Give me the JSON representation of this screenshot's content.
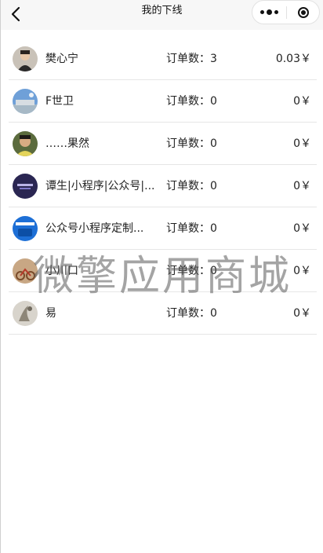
{
  "nav": {
    "title": "我的下线"
  },
  "icons": {
    "back": "chevron-left-icon",
    "more": "more-dots-icon",
    "close": "target-circle-icon"
  },
  "colors": {
    "nav_bg": "#f7f7f7",
    "divider": "#e6e6e6",
    "text": "#222222"
  },
  "list": [
    {
      "name": "樊心宁",
      "order_label": "订单数：",
      "order_count": "3",
      "amount": "0.03￥"
    },
    {
      "name": "F世卫",
      "order_label": "订单数：",
      "order_count": "0",
      "amount": "0￥"
    },
    {
      "name": "……果然",
      "order_label": "订单数：",
      "order_count": "0",
      "amount": "0￥"
    },
    {
      "name": "谭生|小程序|公众号|...",
      "order_label": "订单数：",
      "order_count": "0",
      "amount": "0￥"
    },
    {
      "name": "公众号小程序定制...",
      "order_label": "订单数：",
      "order_count": "0",
      "amount": "0￥"
    },
    {
      "name": "小川口",
      "order_label": "订单数：",
      "order_count": "0",
      "amount": "0￥"
    },
    {
      "name": "易",
      "order_label": "订单数：",
      "order_count": "0",
      "amount": "0￥"
    }
  ],
  "watermark": "微擎应用商城"
}
